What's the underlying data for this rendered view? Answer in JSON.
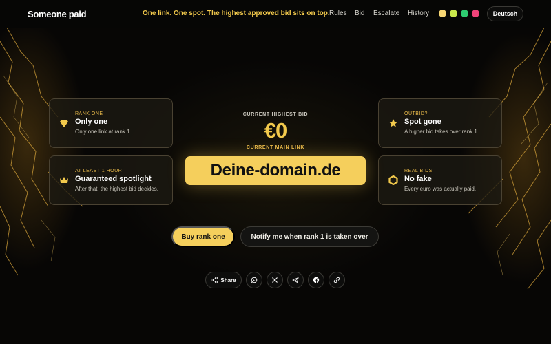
{
  "header": {
    "brand": "Someone paid",
    "tagline": "One link. One spot. The highest approved bid sits on top.",
    "nav": [
      "Rules",
      "Bid",
      "Escalate",
      "History"
    ],
    "theme_colors": [
      "#f7d774",
      "#c9e84b",
      "#2ecc71",
      "#f0437a"
    ],
    "language_button": "Deutsch"
  },
  "cards": {
    "rank_one": {
      "eyebrow": "RANK ONE",
      "title": "Only one",
      "desc": "Only one link at rank 1.",
      "icon": "diamond-icon"
    },
    "spotlight": {
      "eyebrow": "AT LEAST 1 HOUR",
      "title": "Guaranteed spotlight",
      "desc": "After that, the highest bid decides.",
      "icon": "crown-icon"
    },
    "outbid": {
      "eyebrow": "OUTBID?",
      "title": "Spot gone",
      "desc": "A higher bid takes over rank 1.",
      "icon": "star-icon"
    },
    "real_bids": {
      "eyebrow": "REAL BIDS",
      "title": "No fake",
      "desc": "Every euro was actually paid.",
      "icon": "hexagon-icon"
    }
  },
  "main": {
    "highest_bid_label": "CURRENT HIGHEST BID",
    "highest_bid_value": "€0",
    "main_link_label": "CURRENT MAIN LINK",
    "main_link": "Deine-domain.de"
  },
  "actions": {
    "buy": "Buy rank one",
    "notify": "Notify me when rank 1 is taken over"
  },
  "share": {
    "label": "Share",
    "targets": [
      "whatsapp-icon",
      "x-icon",
      "telegram-icon",
      "facebook-icon",
      "link-icon"
    ]
  },
  "colors": {
    "accent": "#f5cf5c",
    "accent_text": "#f2c94c",
    "background": "#060605"
  }
}
